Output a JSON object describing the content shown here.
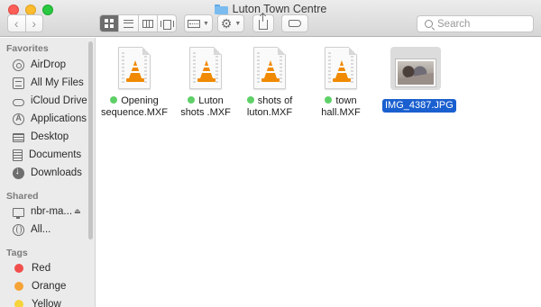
{
  "window": {
    "title": "Luton Town Centre"
  },
  "toolbar": {
    "search_placeholder": "Search"
  },
  "sidebar": {
    "favorites_heading": "Favorites",
    "favorites": [
      {
        "label": "AirDrop",
        "icon": "airdrop-icon"
      },
      {
        "label": "All My Files",
        "icon": "all-my-files-icon"
      },
      {
        "label": "iCloud Drive",
        "icon": "icloud-icon"
      },
      {
        "label": "Applications",
        "icon": "applications-icon"
      },
      {
        "label": "Desktop",
        "icon": "desktop-icon"
      },
      {
        "label": "Documents",
        "icon": "documents-icon"
      },
      {
        "label": "Downloads",
        "icon": "downloads-icon"
      }
    ],
    "shared_heading": "Shared",
    "shared": [
      {
        "label": "nbr-ma...",
        "icon": "monitor-icon"
      },
      {
        "label": "All...",
        "icon": "globe-icon"
      }
    ],
    "tags_heading": "Tags",
    "tags": [
      {
        "label": "Red",
        "color": "#f14f4c"
      },
      {
        "label": "Orange",
        "color": "#f6a438"
      },
      {
        "label": "Yellow",
        "color": "#f7d33c"
      }
    ]
  },
  "files": [
    {
      "name": "Opening sequence.MXF",
      "line1": "Opening",
      "line2": "sequence.MXF",
      "tag_color": "#5fd068",
      "icon": "vlc-cone-icon"
    },
    {
      "name": "Luton shots .MXF",
      "line1": "Luton",
      "line2": "shots .MXF",
      "tag_color": "#5fd068",
      "icon": "vlc-cone-icon"
    },
    {
      "name": "shots of luton.MXF",
      "line1": "shots of",
      "line2": "luton.MXF",
      "tag_color": "#5fd068",
      "icon": "vlc-cone-icon"
    },
    {
      "name": "town hall.MXF",
      "line1": "town hall.MXF",
      "line2": "",
      "tag_color": "#5fd068",
      "icon": "vlc-cone-icon"
    },
    {
      "name": "IMG_4387.JPG",
      "selected": true,
      "icon": "photo-thumbnail"
    }
  ],
  "colors": {
    "selection": "#1a5fcf",
    "accent_folder": "#7bbcf0"
  }
}
